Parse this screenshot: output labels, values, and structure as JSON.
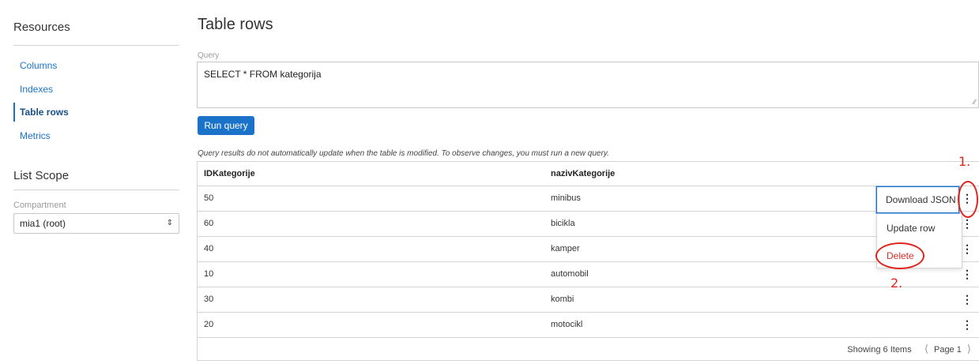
{
  "sidebar": {
    "resources_heading": "Resources",
    "nav": [
      {
        "label": "Columns",
        "active": false
      },
      {
        "label": "Indexes",
        "active": false
      },
      {
        "label": "Table rows",
        "active": true
      },
      {
        "label": "Metrics",
        "active": false
      }
    ],
    "list_scope_heading": "List Scope",
    "compartment_label": "Compartment",
    "compartment_value": "mia1 (root)"
  },
  "main": {
    "title": "Table rows",
    "query_label": "Query",
    "query_value": "SELECT * FROM kategorija",
    "run_button": "Run query",
    "note": "Query results do not automatically update when the table is modified. To observe changes, you must run a new query.",
    "table": {
      "columns": [
        "IDKategorije",
        "nazivKategorije"
      ],
      "rows": [
        [
          "50",
          "minibus"
        ],
        [
          "60",
          "bicikla"
        ],
        [
          "40",
          "kamper"
        ],
        [
          "10",
          "automobil"
        ],
        [
          "30",
          "kombi"
        ],
        [
          "20",
          "motocikl"
        ]
      ]
    },
    "footer": {
      "showing": "Showing 6 Items",
      "page": "Page 1"
    }
  },
  "row_menu": {
    "items": [
      "Download JSON",
      "Update row",
      "Delete"
    ]
  },
  "annotations": {
    "step1": "1.",
    "step2": "2.",
    "color": "#e0241b"
  },
  "colors": {
    "accent": "#1a73c8",
    "danger": "#d62f2f"
  }
}
